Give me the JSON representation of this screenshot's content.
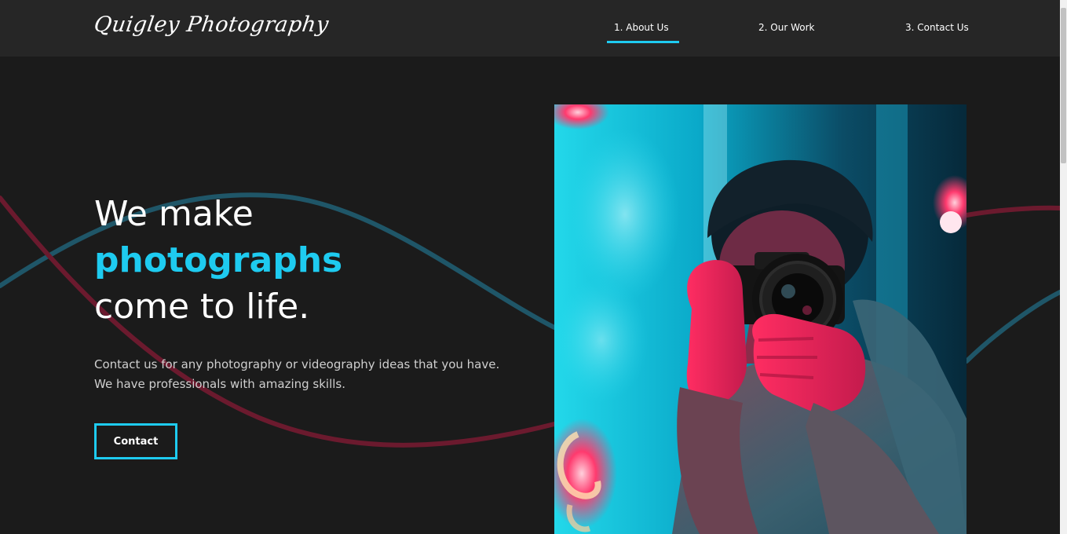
{
  "header": {
    "logo_text": "Quigley Photography",
    "nav": [
      {
        "label": "1. About Us",
        "active": true
      },
      {
        "label": "2. Our Work",
        "active": false
      },
      {
        "label": "3. Contact Us",
        "active": false
      }
    ]
  },
  "hero": {
    "title_line1": "We make",
    "title_accent": "photographs",
    "title_line3": "come to life.",
    "description": "Contact us for any photography or videography ideas that you have. We have professionals with amazing skills.",
    "button_label": "Contact"
  },
  "colors": {
    "accent": "#1ecbf0",
    "background": "#1b1b1b",
    "header_bg": "#262626",
    "wave_teal": "#1f5668",
    "wave_red": "#6b1a2e"
  }
}
